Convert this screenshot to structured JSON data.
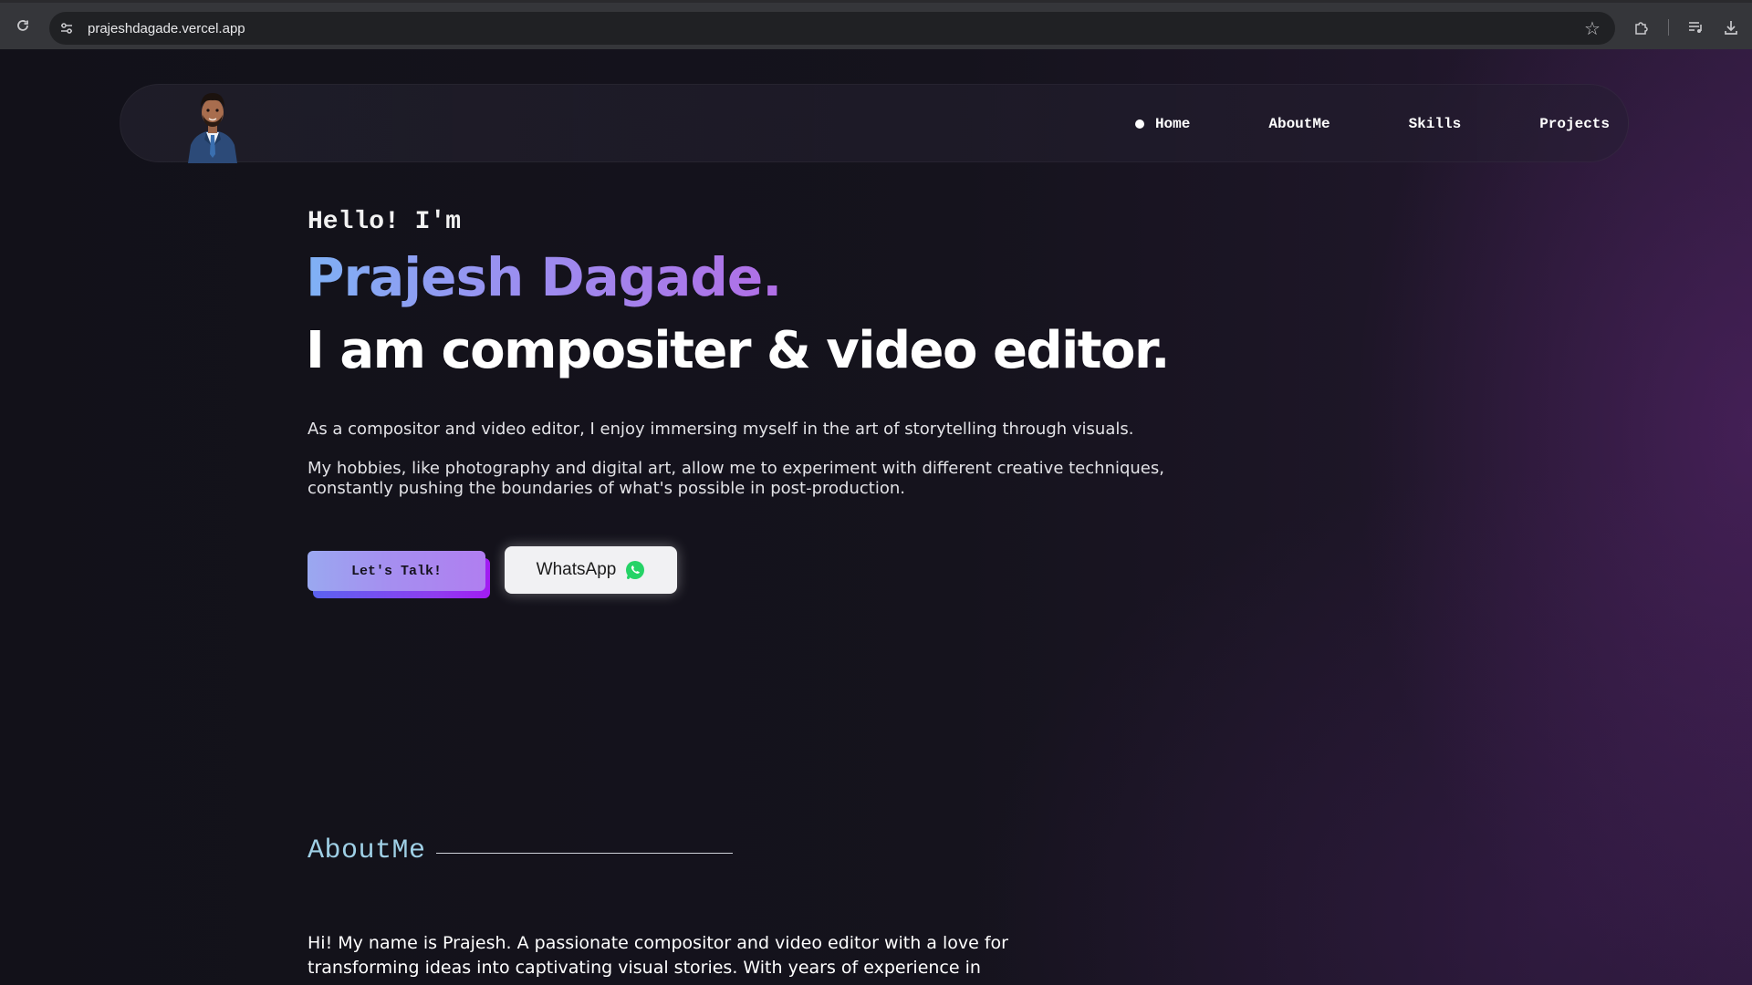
{
  "browser": {
    "url": "prajeshdagade.vercel.app"
  },
  "nav": {
    "items": [
      {
        "label": "Home",
        "active": true
      },
      {
        "label": "AboutMe",
        "active": false
      },
      {
        "label": "Skills",
        "active": false
      },
      {
        "label": "Projects",
        "active": false
      }
    ]
  },
  "hero": {
    "greeting": "Hello! I'm",
    "name": "Prajesh Dagade.",
    "tagline": "I am compositer & video editor.",
    "paragraph1": "As a compositor and video editor, I enjoy immersing myself in the art of storytelling through visuals.",
    "paragraph2": "My hobbies, like photography and digital art, allow me to experiment with different creative techniques, constantly pushing the boundaries of what's possible in post-production.",
    "talk_button": "Let's Talk!",
    "whatsapp_button": "WhatsApp"
  },
  "about": {
    "title": "AboutMe",
    "text": "Hi! My name is Prajesh. A passionate compositor and video editor with a love for transforming ideas into captivating visual stories. With years of experience in VFX"
  },
  "colors": {
    "background": "#14121c",
    "name_gradient_start": "#7fb1f5",
    "name_gradient_end": "#b16ee6",
    "section_title": "#9fd0e6",
    "whatsapp_green": "#25d366"
  },
  "icons": {
    "reload": "reload-icon",
    "site_info": "site-info-icon",
    "bookmark": "star-icon",
    "extensions": "puzzle-icon",
    "media": "media-control-icon",
    "download": "download-icon",
    "whatsapp": "whatsapp-icon"
  }
}
